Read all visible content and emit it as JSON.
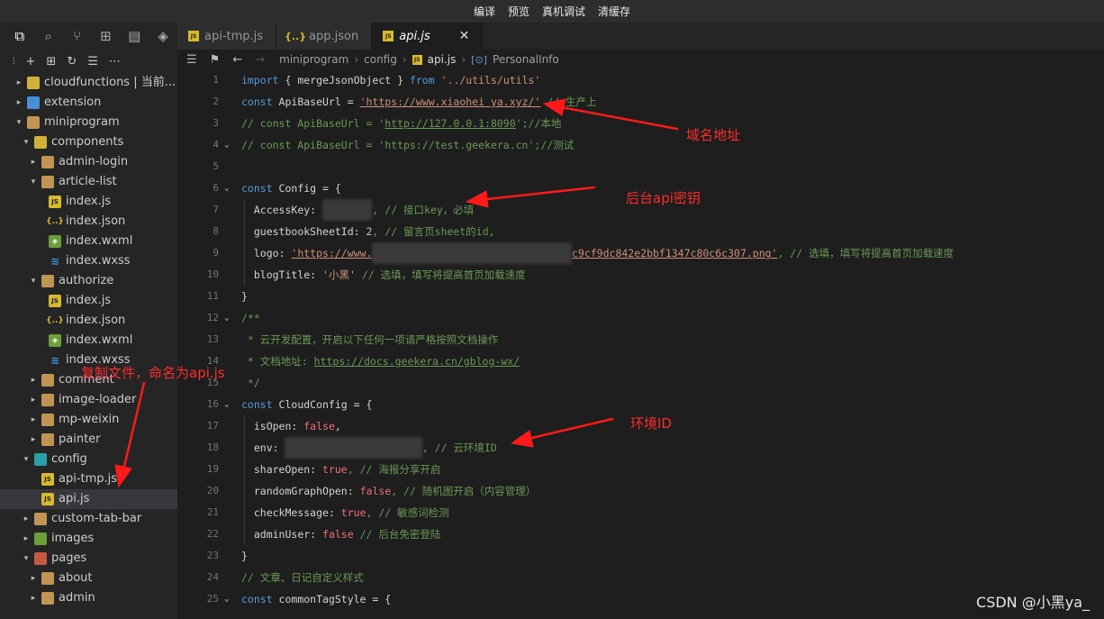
{
  "menu": {
    "items": [
      "编译",
      "预览",
      "真机调试",
      "清缓存"
    ]
  },
  "activity_icons": [
    "files-icon",
    "search-icon",
    "source-control-icon",
    "extensions-icon",
    "storage-icon",
    "docker-icon"
  ],
  "explorer": {
    "toolbar": [
      "collapse-icon",
      "new-file-icon",
      "new-folder-icon",
      "refresh-icon",
      "filter-icon",
      "more-icon"
    ],
    "tree": [
      {
        "label": "cloudfunctions | 当前...",
        "type": "folder-yellow",
        "depth": 1,
        "open": false
      },
      {
        "label": "extension",
        "type": "folder-blue",
        "depth": 1,
        "open": false
      },
      {
        "label": "miniprogram",
        "type": "folder",
        "depth": 1,
        "open": true
      },
      {
        "label": "components",
        "type": "folder-yellow",
        "depth": 2,
        "open": true
      },
      {
        "label": "admin-login",
        "type": "folder",
        "depth": 3,
        "open": false
      },
      {
        "label": "article-list",
        "type": "folder",
        "depth": 3,
        "open": true
      },
      {
        "label": "index.js",
        "type": "js",
        "depth": 4
      },
      {
        "label": "index.json",
        "type": "json",
        "depth": 4
      },
      {
        "label": "index.wxml",
        "type": "wxml",
        "depth": 4
      },
      {
        "label": "index.wxss",
        "type": "wxss",
        "depth": 4
      },
      {
        "label": "authorize",
        "type": "folder",
        "depth": 3,
        "open": true
      },
      {
        "label": "index.js",
        "type": "js",
        "depth": 4
      },
      {
        "label": "index.json",
        "type": "json",
        "depth": 4
      },
      {
        "label": "index.wxml",
        "type": "wxml",
        "depth": 4
      },
      {
        "label": "index.wxss",
        "type": "wxss",
        "depth": 4
      },
      {
        "label": "comment",
        "type": "folder",
        "depth": 3,
        "open": false
      },
      {
        "label": "image-loader",
        "type": "folder",
        "depth": 3,
        "open": false
      },
      {
        "label": "mp-weixin",
        "type": "folder",
        "depth": 3,
        "open": false
      },
      {
        "label": "painter",
        "type": "folder",
        "depth": 3,
        "open": false
      },
      {
        "label": "config",
        "type": "folder-teal",
        "depth": 2,
        "open": true
      },
      {
        "label": "api-tmp.js",
        "type": "js",
        "depth": 3
      },
      {
        "label": "api.js",
        "type": "js",
        "depth": 3,
        "selected": true
      },
      {
        "label": "custom-tab-bar",
        "type": "folder",
        "depth": 2,
        "open": false
      },
      {
        "label": "images",
        "type": "folder-green",
        "depth": 2,
        "open": false
      },
      {
        "label": "pages",
        "type": "folder-red",
        "depth": 2,
        "open": true
      },
      {
        "label": "about",
        "type": "folder",
        "depth": 3,
        "open": false
      },
      {
        "label": "admin",
        "type": "folder",
        "depth": 3,
        "open": false
      }
    ]
  },
  "tabs": [
    {
      "label": "api-tmp.js",
      "icon": "js",
      "active": false
    },
    {
      "label": "app.json",
      "icon": "json",
      "active": false
    },
    {
      "label": "api.js",
      "icon": "js",
      "active": true
    }
  ],
  "breadcrumb": {
    "items": [
      "miniprogram",
      "config",
      "api.js",
      "PersonalInfo"
    ]
  },
  "annotations": {
    "domain": "域名地址",
    "api_key": "后台api密钥",
    "env_id": "环境ID",
    "copy_file": "复制文件，命名为api.js"
  },
  "watermark": "CSDN @小黑ya_",
  "code_lines": [
    {
      "n": "1"
    },
    {
      "n": "2"
    },
    {
      "n": "3"
    },
    {
      "n": "4"
    },
    {
      "n": "5"
    },
    {
      "n": "6"
    },
    {
      "n": "7"
    },
    {
      "n": "8"
    },
    {
      "n": "9"
    },
    {
      "n": "10"
    },
    {
      "n": "11"
    },
    {
      "n": "12"
    },
    {
      "n": "13"
    },
    {
      "n": "14"
    },
    {
      "n": "15"
    },
    {
      "n": "16"
    },
    {
      "n": "17"
    },
    {
      "n": "18"
    },
    {
      "n": "19"
    },
    {
      "n": "20"
    },
    {
      "n": "21"
    },
    {
      "n": "22"
    },
    {
      "n": "23"
    },
    {
      "n": "24"
    },
    {
      "n": "25"
    }
  ],
  "code": {
    "l1": [
      "import",
      " { mergeJsonObject } ",
      "from",
      " ",
      "'../utils/utils'"
    ],
    "l2": [
      "const",
      " ApiBaseUrl = ",
      "'https://www.xiaohei ya.xyz/'",
      " // 生产上"
    ],
    "l3": [
      "// const ApiBaseUrl = '",
      "http://127.0.0.1:8090",
      "';//本地"
    ],
    "l4": [
      "// const ApiBaseUrl = 'https://test.geekera.cn';//测试"
    ],
    "l6": [
      "const",
      " Config = {"
    ],
    "l7": [
      "AccessKey: ",
      "'xxxxxx'",
      ", // 接口key，必填"
    ],
    "l8": [
      "guestbookSheetId: ",
      "2",
      ", // 留言页sheet的id,"
    ],
    "l9": [
      "logo: ",
      "'https://www.",
      "xxxxxxxxxxxxxxxxxxxxxxxxxxxxxxxx",
      "c9cf9dc842e2bbf1347c80c6c307.png'",
      ", // 选填，填写将提高首页加载速度"
    ],
    "l10": [
      "blogTitle: ",
      "'小黑'",
      " // 选填，填写将提高首页加载速度"
    ],
    "l11": [
      "}"
    ],
    "l12": [
      "/**"
    ],
    "l13": [
      " * 云开发配置，开启以下任何一项请严格按照文档操作"
    ],
    "l14": [
      " * 文档地址: ",
      "https://docs.geekera.cn/gblog-wx/"
    ],
    "l15": [
      " */"
    ],
    "l16": [
      "const",
      " CloudConfig = {"
    ],
    "l17": [
      "isOpen: ",
      "false",
      ","
    ],
    "l18": [
      "env: ",
      "'xxxxxxxxxxxxxxxxxxxx'",
      ", // 云环境ID"
    ],
    "l19": [
      "shareOpen: ",
      "true",
      ", // 海报分享开启"
    ],
    "l20": [
      "randomGraphOpen: ",
      "false",
      ", // 随机图开启（内容管理）"
    ],
    "l21": [
      "checkMessage: ",
      "true",
      ", // 敏感词检测"
    ],
    "l22": [
      "adminUser: ",
      "false",
      " // 后台免密登陆"
    ],
    "l23": [
      "}"
    ],
    "l24": [
      "// 文章、日记自定义样式"
    ],
    "l25": [
      "const",
      " commonTagStyle = {"
    ]
  }
}
